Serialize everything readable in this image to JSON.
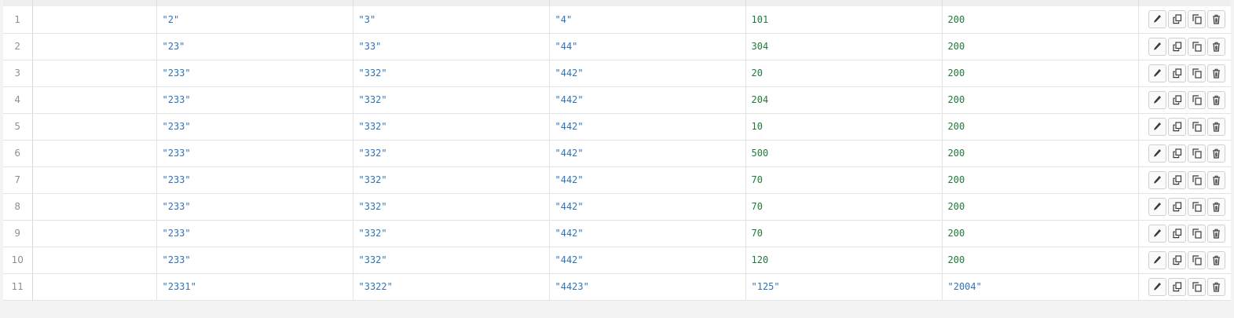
{
  "rows": [
    {
      "num": "1",
      "c1": "",
      "c2": "\"2\"",
      "c3": "\"3\"",
      "c4": "\"4\"",
      "c5": "101",
      "c6": "200"
    },
    {
      "num": "2",
      "c1": "",
      "c2": "\"23\"",
      "c3": "\"33\"",
      "c4": "\"44\"",
      "c5": "304",
      "c6": "200"
    },
    {
      "num": "3",
      "c1": "",
      "c2": "\"233\"",
      "c3": "\"332\"",
      "c4": "\"442\"",
      "c5": "20",
      "c6": "200"
    },
    {
      "num": "4",
      "c1": "",
      "c2": "\"233\"",
      "c3": "\"332\"",
      "c4": "\"442\"",
      "c5": "204",
      "c6": "200"
    },
    {
      "num": "5",
      "c1": "",
      "c2": "\"233\"",
      "c3": "\"332\"",
      "c4": "\"442\"",
      "c5": "10",
      "c6": "200"
    },
    {
      "num": "6",
      "c1": "",
      "c2": "\"233\"",
      "c3": "\"332\"",
      "c4": "\"442\"",
      "c5": "500",
      "c6": "200"
    },
    {
      "num": "7",
      "c1": "",
      "c2": "\"233\"",
      "c3": "\"332\"",
      "c4": "\"442\"",
      "c5": "70",
      "c6": "200"
    },
    {
      "num": "8",
      "c1": "",
      "c2": "\"233\"",
      "c3": "\"332\"",
      "c4": "\"442\"",
      "c5": "70",
      "c6": "200"
    },
    {
      "num": "9",
      "c1": "",
      "c2": "\"233\"",
      "c3": "\"332\"",
      "c4": "\"442\"",
      "c5": "70",
      "c6": "200"
    },
    {
      "num": "10",
      "c1": "",
      "c2": "\"233\"",
      "c3": "\"332\"",
      "c4": "\"442\"",
      "c5": "120",
      "c6": "200"
    },
    {
      "num": "11",
      "c1": "",
      "c2": "\"2331\"",
      "c3": "\"3322\"",
      "c4": "\"4423\"",
      "c5": "\"125\"",
      "c6": "\"2004\""
    }
  ],
  "row_actions": [
    {
      "name": "edit-button",
      "icon": "pencil-icon"
    },
    {
      "name": "copy-button",
      "icon": "copy-icon"
    },
    {
      "name": "duplicate-button",
      "icon": "duplicate-icon"
    },
    {
      "name": "delete-button",
      "icon": "trash-icon"
    }
  ],
  "colors": {
    "string_value": "#2f74b8",
    "number_value": "#1f7a3a",
    "row_number": "#8b9096",
    "grid_line": "#e3e3e3"
  }
}
